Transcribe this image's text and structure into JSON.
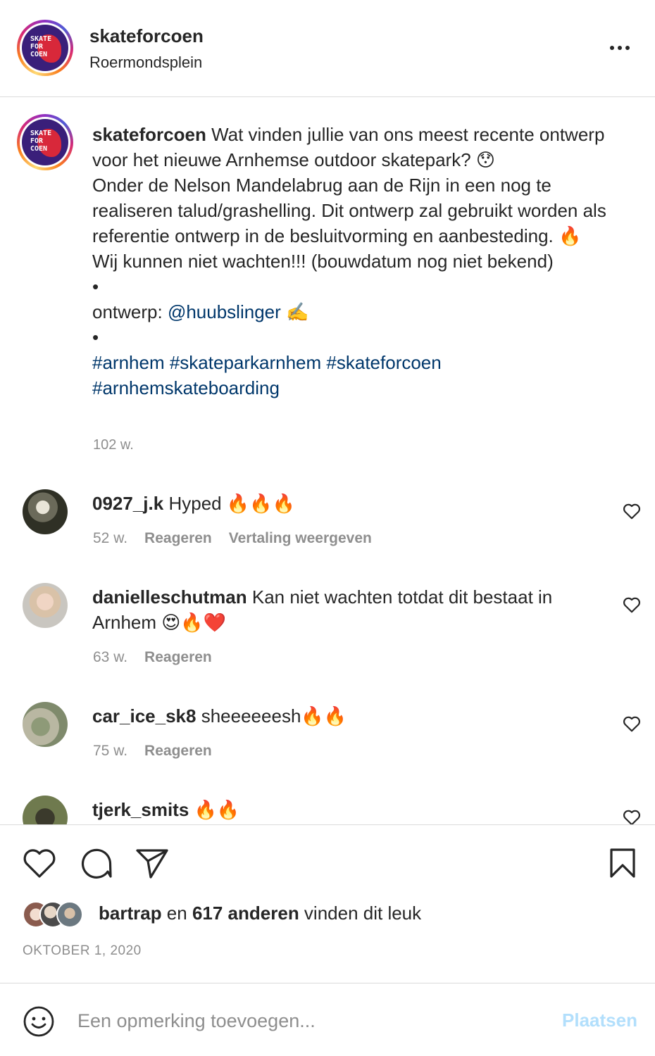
{
  "header": {
    "username": "skateforcoen",
    "location": "Roermondsplein",
    "logo_text": "SKATE FOR COEN"
  },
  "caption": {
    "username": "skateforcoen",
    "line1": "Wat vinden jullie van ons meest recente ontwerp voor het nieuwe Arnhemse outdoor skatepark? 😯",
    "line2": "Onder de Nelson Mandelabrug aan de Rijn in een nog te realiseren talud/grashelling. Dit ontwerp zal gebruikt worden als referentie ontwerp in de besluitvorming en aanbesteding. 🔥",
    "line3": "Wij kunnen niet wachten!!! (bouwdatum nog niet bekend)",
    "bullet": "•",
    "credit_prefix": "ontwerp: ",
    "mention": "@huubslinger",
    "credit_suffix": " ✍️",
    "hashtags": "#arnhem #skateparkarnhem #skateforcoen #arnhemskateboarding",
    "time": "102 w."
  },
  "comments": [
    {
      "username": "0927_j.k",
      "text": "Hyped 🔥🔥🔥",
      "time": "52 w.",
      "reply": "Reageren",
      "translate": "Vertaling weergeven"
    },
    {
      "username": "danielleschutman",
      "text": "Kan niet wachten totdat dit bestaat in Arnhem 😍🔥❤️",
      "time": "63 w.",
      "reply": "Reageren"
    },
    {
      "username": "car_ice_sk8",
      "text": "sheeeeeesh🔥🔥",
      "time": "75 w.",
      "reply": "Reageren"
    },
    {
      "username": "tjerk_smits",
      "text": "🔥🔥"
    }
  ],
  "likes": {
    "user": "bartrap",
    "connector": " en ",
    "count": "617 anderen",
    "suffix": " vinden dit leuk"
  },
  "date": "OKTOBER 1, 2020",
  "composer": {
    "placeholder": "Een opmerking toevoegen...",
    "post_label": "Plaatsen"
  },
  "colors": {
    "link": "#00376b",
    "muted": "#8e8e8e",
    "post_disabled": "#b2dffc"
  }
}
